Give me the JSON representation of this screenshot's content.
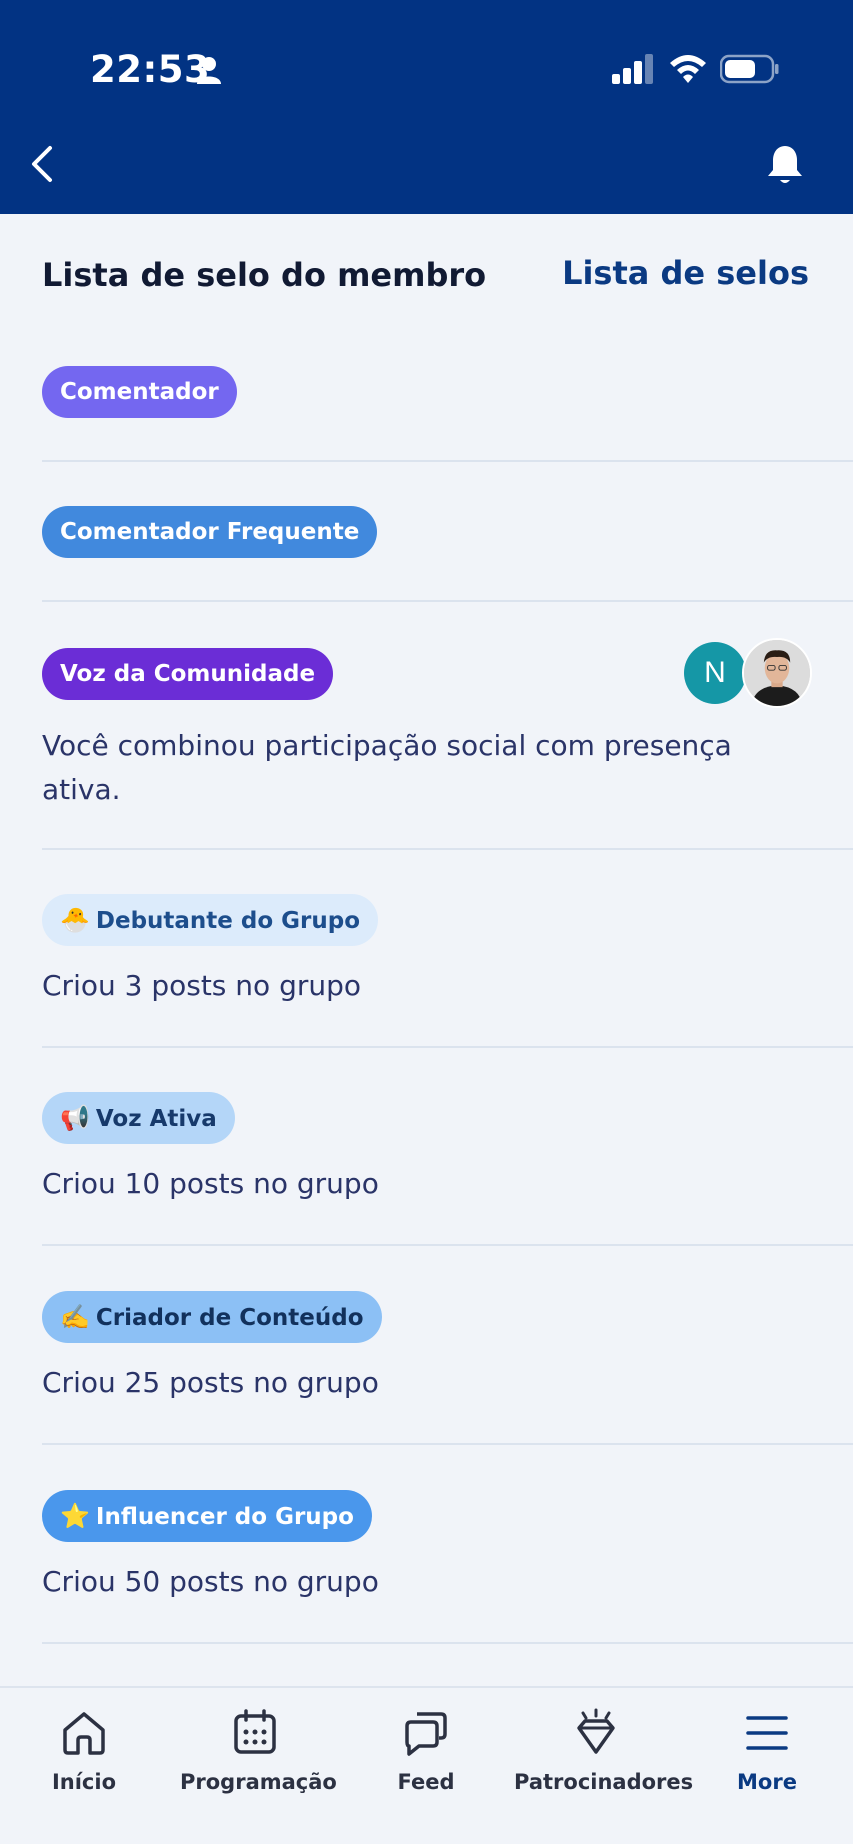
{
  "status_bar": {
    "time": "22:53"
  },
  "header": {
    "back_icon": "chevron-left-icon",
    "notification_icon": "bell-icon"
  },
  "page": {
    "title": "Lista de selo do membro",
    "link": "Lista de selos"
  },
  "badges": [
    {
      "label": "Comentador",
      "emoji": "",
      "description": "",
      "bg": "#7467f0",
      "fg": "#ffffff"
    },
    {
      "label": "Comentador Frequente",
      "emoji": "",
      "description": "",
      "bg": "#4189dd",
      "fg": "#ffffff"
    },
    {
      "label": "Voz da Comunidade",
      "emoji": "",
      "description": "Você combinou participação social com presença ativa.",
      "bg": "#6b2dd6",
      "fg": "#ffffff",
      "avatars": [
        "N"
      ]
    },
    {
      "label": "Debutante do Grupo",
      "emoji": "🐣",
      "description": "Criou 3 posts no grupo",
      "bg": "#dcebfb",
      "fg": "#1d4e8c"
    },
    {
      "label": "Voz Ativa",
      "emoji": "📢",
      "description": "Criou 10 posts no grupo",
      "bg": "#b4d6f8",
      "fg": "#173a6b"
    },
    {
      "label": "Criador de Conteúdo",
      "emoji": "✍️",
      "description": "Criou 25 posts no grupo",
      "bg": "#8cc0f5",
      "fg": "#12315c"
    },
    {
      "label": "Influencer do Grupo",
      "emoji": "⭐",
      "description": "Criou 50 posts no grupo",
      "bg": "#4a97ec",
      "fg": "#ffffff"
    }
  ],
  "nav": {
    "items": [
      {
        "label": "Início",
        "icon": "home-icon"
      },
      {
        "label": "Programação",
        "icon": "calendar-icon"
      },
      {
        "label": "Feed",
        "icon": "chat-icon"
      },
      {
        "label": "Patrocinadores",
        "icon": "diamond-icon"
      },
      {
        "label": "More",
        "icon": "menu-icon"
      }
    ]
  }
}
